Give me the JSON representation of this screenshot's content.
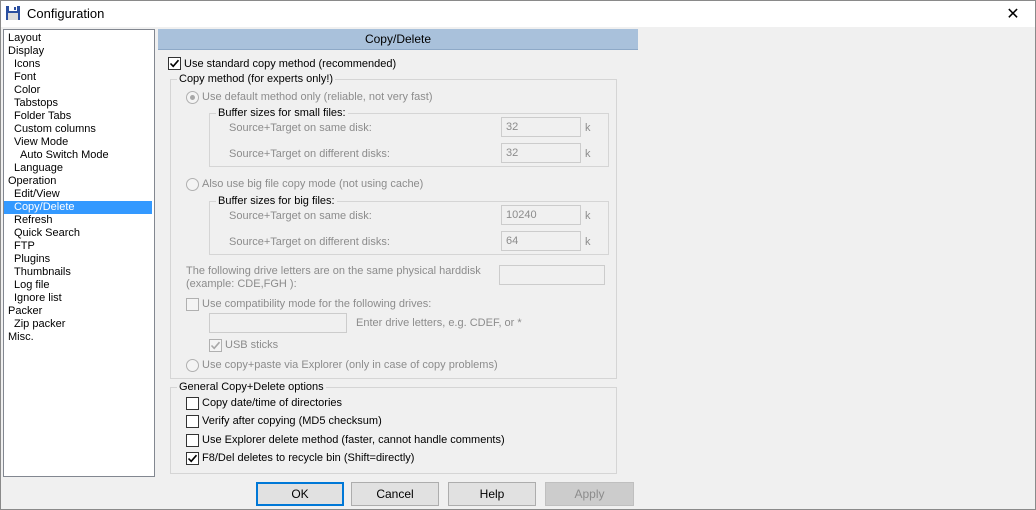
{
  "window": {
    "title": "Configuration"
  },
  "tree": [
    "Layout",
    "Display",
    "Icons",
    "Font",
    "Color",
    "Tabstops",
    "Folder Tabs",
    "Custom columns",
    "View Mode",
    "Auto Switch Mode",
    "Language",
    "Operation",
    "Edit/View",
    "Copy/Delete",
    "Refresh",
    "Quick Search",
    "FTP",
    "Plugins",
    "Thumbnails",
    "Log file",
    "Ignore list",
    "Packer",
    "Zip packer",
    "Misc."
  ],
  "header": {
    "title": "Copy/Delete"
  },
  "standard": {
    "label": "Use standard copy method (recommended)"
  },
  "copy_method": {
    "title": "Copy method (for experts only!)",
    "default_label": "Use default method only (reliable, not very fast)",
    "small": {
      "title": "Buffer sizes for small files:",
      "same_label": "Source+Target on same disk:",
      "same_value": "32",
      "diff_label": "Source+Target on different disks:",
      "diff_value": "32",
      "unit": "k"
    },
    "big_label": "Also use big file copy mode (not using cache)",
    "big": {
      "title": "Buffer sizes for big files:",
      "same_label": "Source+Target on same disk:",
      "same_value": "10240",
      "diff_label": "Source+Target on different disks:",
      "diff_value": "64",
      "unit": "k"
    },
    "drive_label_1": "The following drive letters are on the same physical harddisk",
    "drive_label_2": "(example: CDE,FGH ):",
    "drive_value": "",
    "compat_label": "Use compatibility mode for the following drives:",
    "compat_value": "",
    "compat_hint": "Enter drive letters, e.g. CDEF, or *",
    "usb_label": "USB sticks",
    "explorer_label": "Use copy+paste via Explorer (only in case of copy problems)"
  },
  "general": {
    "title": "General Copy+Delete options",
    "opt1": "Copy date/time of directories",
    "opt2": "Verify after copying (MD5 checksum)",
    "opt3": "Use Explorer delete method (faster, cannot handle comments)",
    "opt4": "F8/Del deletes to recycle bin (Shift=directly)"
  },
  "buttons": {
    "ok": "OK",
    "cancel": "Cancel",
    "help": "Help",
    "apply": "Apply"
  }
}
